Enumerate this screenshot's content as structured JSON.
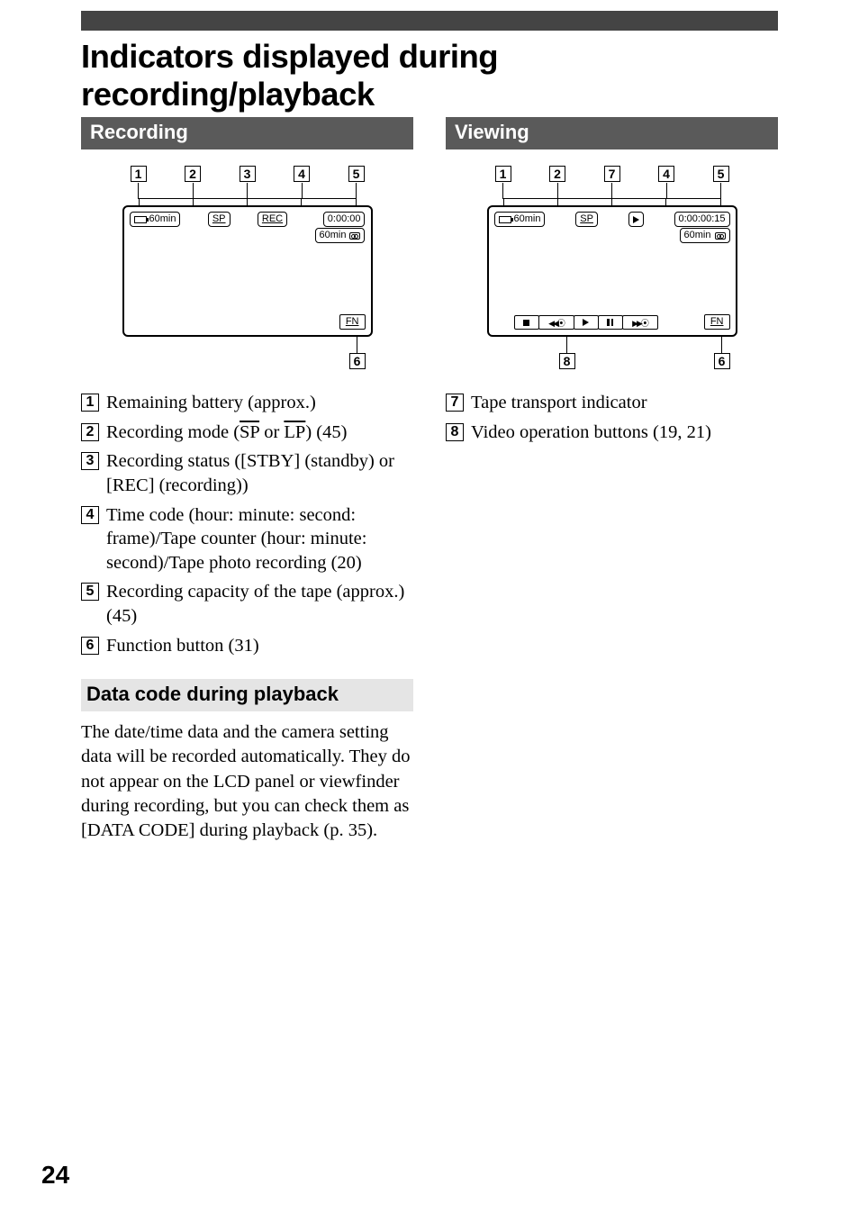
{
  "page": {
    "number": "24",
    "title": "Indicators displayed during recording/playback"
  },
  "recording": {
    "heading": "Recording",
    "callouts": [
      "1",
      "2",
      "3",
      "4",
      "5"
    ],
    "below_callouts": [
      "6"
    ],
    "panel": {
      "battery": "60min",
      "mode": "SP",
      "status": "REC",
      "timecode": "0:00:00",
      "tape_remaining": "60min",
      "fn": "FN"
    },
    "legend": [
      {
        "n": "1",
        "text": "Remaining battery (approx.)"
      },
      {
        "n": "2",
        "text_html": "Recording mode (<span class=\"overline\">SP</span> or <span class=\"overline\">LP</span>) (45)"
      },
      {
        "n": "3",
        "text": "Recording status ([STBY] (standby) or [REC] (recording))"
      },
      {
        "n": "4",
        "text": "Time code (hour: minute: second: frame)/Tape counter (hour: minute: second)/Tape photo recording (20)"
      },
      {
        "n": "5",
        "text": "Recording capacity of the tape (approx.) (45)"
      },
      {
        "n": "6",
        "text": "Function button (31)"
      }
    ]
  },
  "data_code": {
    "heading": "Data code during playback",
    "body": "The date/time data and the camera setting data will be recorded automatically. They do not appear on the LCD panel or viewfinder during recording, but you can check them as [DATA CODE] during playback (p. 35)."
  },
  "viewing": {
    "heading": "Viewing",
    "callouts": [
      "1",
      "2",
      "7",
      "4",
      "5"
    ],
    "below_callouts": [
      "8",
      "6"
    ],
    "panel": {
      "battery": "60min",
      "mode": "SP",
      "transport_icon": "play",
      "timecode": "0:00:00:15",
      "tape_remaining": "60min",
      "fn": "FN",
      "video_buttons": [
        "stop",
        "rew",
        "play",
        "pause",
        "ff"
      ]
    },
    "legend": [
      {
        "n": "7",
        "text": "Tape transport indicator"
      },
      {
        "n": "8",
        "text": "Video operation buttons (19, 21)"
      }
    ]
  }
}
